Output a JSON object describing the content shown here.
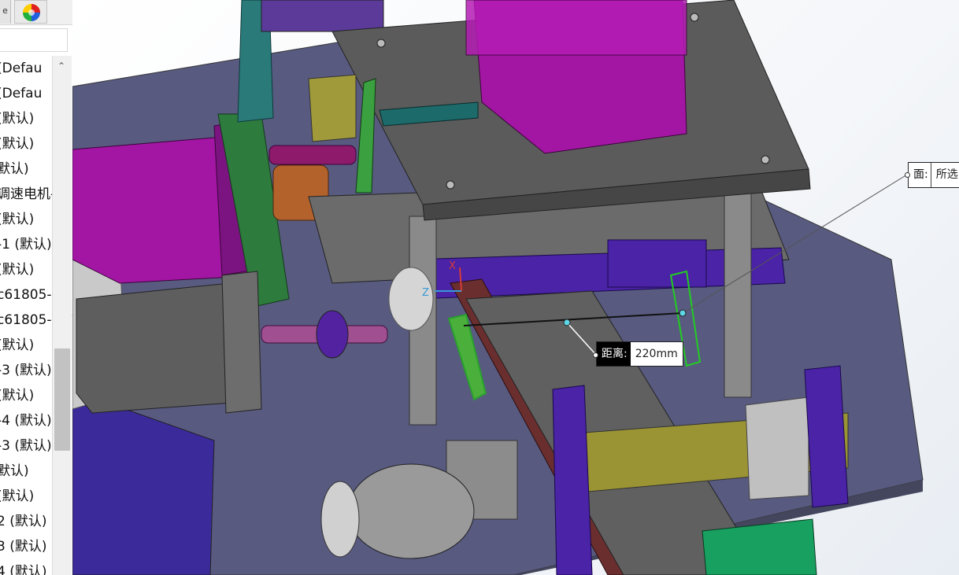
{
  "tree": {
    "tab_stub_label": "e",
    "items": [
      "(Defau",
      "(Defau",
      "(默认)",
      "(默认)",
      "默认)",
      "调速电机-",
      "(默认)",
      "-1 (默认)",
      "(默认)",
      "c61805-",
      "c61805-",
      "(默认)",
      "-3 (默认)",
      "(默认)",
      "-4 (默认)",
      "-3 (默认)",
      "默认)",
      "(默认)",
      "2 (默认)",
      "3 (默认)",
      "4 (默认)"
    ]
  },
  "measure": {
    "distance_label": "距离:",
    "distance_value": "220mm",
    "face_label": "面:",
    "face_value": "所选"
  },
  "triad": {
    "x_label": "X",
    "z_label": "Z"
  },
  "colors": {
    "plate": "#5b5b5b",
    "base": "#585a80",
    "motor": "#a316a3",
    "selection": "#22cc22",
    "rail": "#6a2e2e",
    "bracket": "#4a23a6",
    "yellow_rail": "#9b9434",
    "teal": "#2a7a7a",
    "green": "#18a060"
  },
  "icons": [
    "appearance-icon",
    "scroll-up-icon",
    "collapse-icon"
  ]
}
